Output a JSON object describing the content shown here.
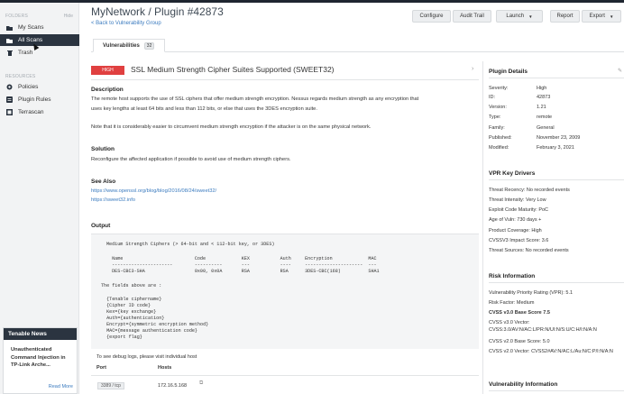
{
  "sidebar": {
    "folders_label": "FOLDERS",
    "hide_label": "Hide",
    "folders": [
      {
        "label": "My Scans",
        "icon": "folder-icon"
      },
      {
        "label": "All Scans",
        "icon": "folder-icon",
        "active": true
      },
      {
        "label": "Trash",
        "icon": "trash-icon"
      }
    ],
    "resources_label": "RESOURCES",
    "resources": [
      {
        "label": "Policies",
        "icon": "gear-icon"
      },
      {
        "label": "Plugin Rules",
        "icon": "rules-icon"
      },
      {
        "label": "Terrascan",
        "icon": "scan-icon"
      }
    ],
    "news": {
      "title": "Tenable News",
      "body": "Unauthenticated Command Injection in TP-Link Arche...",
      "link": "Read More"
    }
  },
  "header": {
    "title": "MyNetwork / Plugin #42873",
    "back": "< Back to Vulnerability Group",
    "buttons": {
      "configure": "Configure",
      "audit_trail": "Audit Trail",
      "launch": "Launch",
      "report": "Report",
      "export": "Export"
    }
  },
  "tabs": [
    {
      "label": "Vulnerabilities",
      "count": "32"
    }
  ],
  "plugin": {
    "severity": "HIGH",
    "name": "SSL Medium Strength Cipher Suites Supported (SWEET32)",
    "description_h": "Description",
    "description_1": "The remote host supports the use of SSL ciphers that offer medium strength encryption. Nessus regards medium strength as any encryption that",
    "description_2": "uses key lengths at least 64 bits and less than 112 bits, or else that uses the 3DES encryption suite.",
    "description_3": "Note that it is considerably easier to circumvent medium strength encryption if the attacker is on the same physical network.",
    "solution_h": "Solution",
    "solution": "Reconfigure the affected application if possible to avoid use of medium strength ciphers.",
    "see_also_h": "See Also",
    "see_also": [
      "https://www.openssl.org/blog/blog/2016/08/24/sweet32/",
      "https://sweet32.info"
    ],
    "output_h": "Output",
    "output_lines": [
      "Medium Strength Ciphers (> 64-bit and < 112-bit key, or 3DES)",
      "  Name                          Code             KEX           Auth     Encryption             MAC",
      "  ----------------------        ----------       ---           ----     ---------------------  ---",
      "  DES-CBC3-SHA                  0x00, 0x0A       RSA           RSA      3DES-CBC(168)          SHA1",
      "The fields above are :",
      "  {Tenable ciphername}",
      "  {Cipher ID code}",
      "  Kex={key exchange}",
      "  Auth={authentication}",
      "  Encrypt={symmetric encryption method}",
      "  MAC={message authentication code}",
      "  {export flag}"
    ],
    "hosts_note": "To see debug logs, please visit individual host",
    "hosts_headers": {
      "port": "Port",
      "hosts": "Hosts"
    },
    "hosts": [
      {
        "port": "3389 / tcp",
        "host": "172.16.5.168"
      }
    ]
  },
  "details": {
    "title": "Plugin Details",
    "items": [
      {
        "k": "Severity:",
        "v": "High"
      },
      {
        "k": "ID:",
        "v": "42873"
      },
      {
        "k": "Version:",
        "v": "1.21"
      },
      {
        "k": "Type:",
        "v": "remote"
      },
      {
        "k": "Family:",
        "v": "General"
      },
      {
        "k": "Published:",
        "v": "November 23, 2009"
      },
      {
        "k": "Modified:",
        "v": "February 3, 2021"
      }
    ]
  },
  "vpr": {
    "title": "VPR Key Drivers",
    "items": [
      "Threat Recency: No recorded events",
      "Threat Intensity: Very Low",
      "Exploit Code Maturity: PoC",
      "Age of Vuln: 730 days +",
      "Product Coverage: High",
      "CVSSV3 Impact Score: 3.6",
      "Threat Sources: No recorded events"
    ]
  },
  "risk": {
    "title": "Risk Information",
    "vpr": "Vulnerability Priority Rating (VPR): 5.1",
    "factor": "Risk Factor: Medium",
    "cvss3_base": "CVSS v3.0 Base Score 7.5",
    "cvss3_vector": "CVSS v3.0 Vector: CVSS:3.0/AV:N/AC:L/PR:N/UI:N/S:U/C:H/I:N/A:N",
    "cvss2_base": "CVSS v2.0 Base Score: 5.0",
    "cvss2_vector": "CVSS v2.0 Vector: CVSS2#AV:N/AC:L/Au:N/C:P/I:N/A:N"
  },
  "vuln_info": {
    "title": "Vulnerability Information"
  }
}
